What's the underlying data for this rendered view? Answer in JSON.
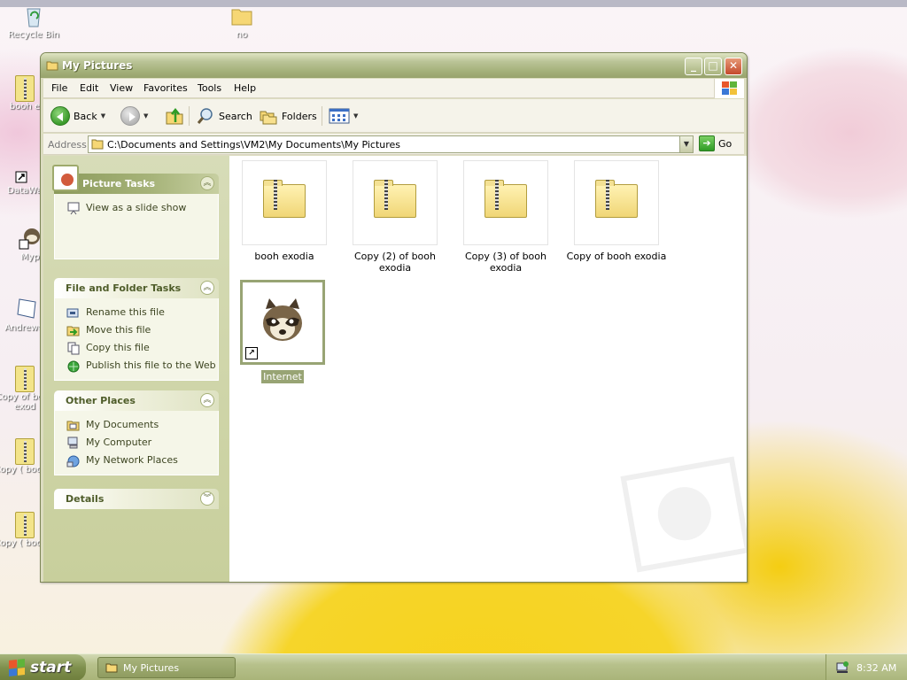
{
  "desktop": {
    "icons": [
      {
        "label": "Recycle Bin"
      },
      {
        "label": "no"
      },
      {
        "label": "booh e"
      },
      {
        "label": "DataWa"
      },
      {
        "label": "Myp"
      },
      {
        "label": "AndrewO"
      },
      {
        "label": "Copy of booh exod"
      },
      {
        "label": "Copy ( booh e"
      },
      {
        "label": "Copy ( booh e"
      }
    ]
  },
  "window": {
    "title": "My Pictures",
    "buttons": {
      "minimize": "_",
      "maximize": "□",
      "close": "✕"
    }
  },
  "menubar": {
    "items": [
      "File",
      "Edit",
      "View",
      "Favorites",
      "Tools",
      "Help"
    ]
  },
  "toolbar": {
    "back_label": "Back",
    "search_label": "Search",
    "folders_label": "Folders"
  },
  "addressbar": {
    "label": "Address",
    "path": "C:\\Documents and Settings\\VM2\\My Documents\\My Pictures",
    "go_label": "Go"
  },
  "taskpane": {
    "picture_tasks": {
      "title": "Picture Tasks",
      "items": [
        {
          "label": "View as a slide show",
          "icon": "slideshow-icon"
        }
      ]
    },
    "file_tasks": {
      "title": "File and Folder Tasks",
      "items": [
        {
          "label": "Rename this file",
          "icon": "rename-icon"
        },
        {
          "label": "Move this file",
          "icon": "move-icon"
        },
        {
          "label": "Copy this file",
          "icon": "copy-icon"
        },
        {
          "label": "Publish this file to the Web",
          "icon": "publish-icon"
        }
      ]
    },
    "other_places": {
      "title": "Other Places",
      "items": [
        {
          "label": "My Documents",
          "icon": "my-documents-icon"
        },
        {
          "label": "My Computer",
          "icon": "my-computer-icon"
        },
        {
          "label": "My Network Places",
          "icon": "network-places-icon"
        }
      ]
    },
    "details": {
      "title": "Details"
    }
  },
  "content": {
    "items": [
      {
        "label": "booh exodia",
        "type": "zip-folder"
      },
      {
        "label": "Copy (2) of booh exodia",
        "type": "zip-folder"
      },
      {
        "label": "Copy (3) of booh exodia",
        "type": "zip-folder"
      },
      {
        "label": "Copy of booh exodia",
        "type": "zip-folder"
      },
      {
        "label": "Internet",
        "type": "shortcut",
        "selected": true
      }
    ]
  },
  "taskbar": {
    "start_label": "start",
    "window_button_label": "My Pictures",
    "clock": "8:32 AM"
  },
  "colors": {
    "theme_olive": "#a6b27c",
    "selection": "#98a474",
    "taskpane_bg": "#d7dcb8"
  }
}
